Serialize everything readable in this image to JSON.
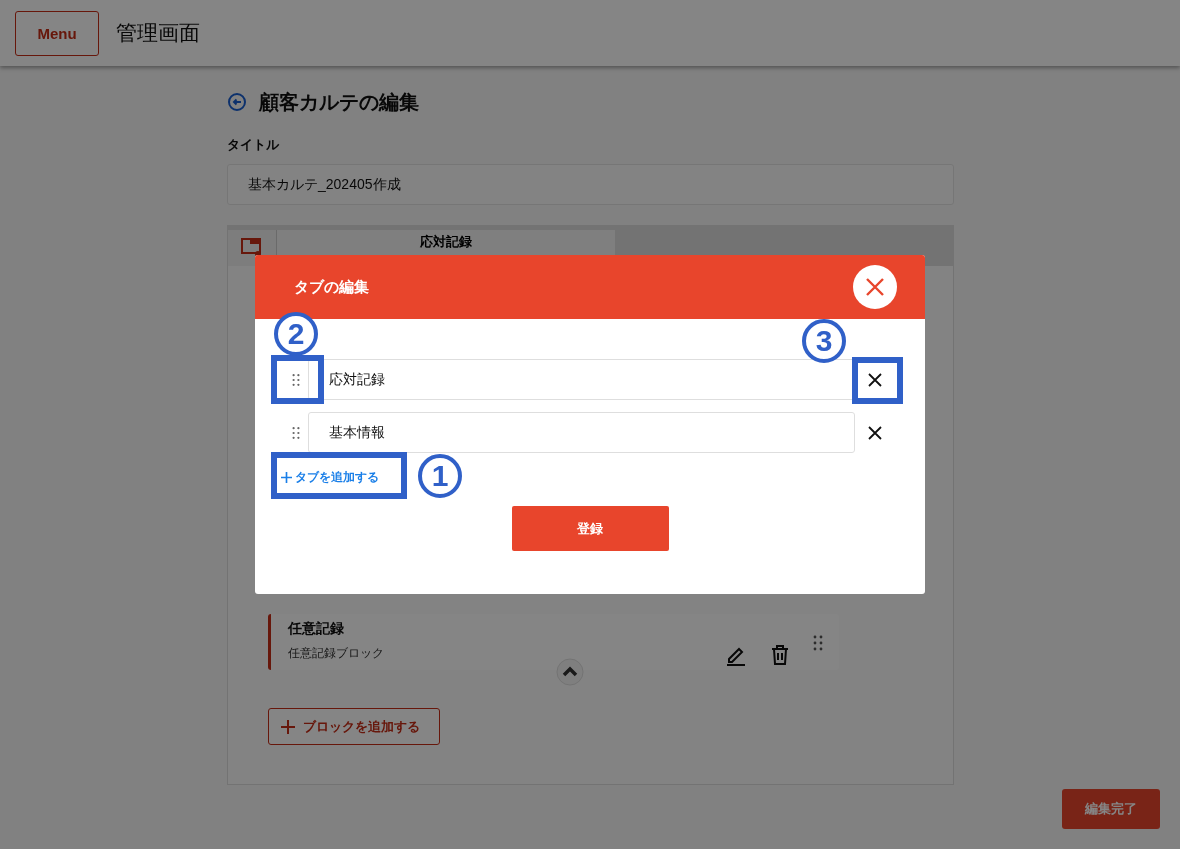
{
  "header": {
    "menu_button": "Menu",
    "title": "管理画面"
  },
  "page": {
    "heading": "顧客カルテの編集",
    "title_label": "タイトル",
    "title_value": "基本カルテ_202405作成"
  },
  "tabs": [
    {
      "label": "応対記録",
      "selected": true
    }
  ],
  "blocks": [
    {
      "title": "任意記録",
      "subtitle": "任意記録ブロック"
    }
  ],
  "add_block_button": "ブロックを追加する",
  "finish_button": "編集完了",
  "modal": {
    "title": "タブの編集",
    "rows": [
      {
        "value": "応対記録"
      },
      {
        "value": "基本情報"
      }
    ],
    "add_tab_link": "タブを追加する",
    "submit_button": "登録"
  },
  "annotations": [
    {
      "label": "2",
      "kind": "handle"
    },
    {
      "label": "3",
      "kind": "delete"
    },
    {
      "label": "1",
      "kind": "add"
    }
  ]
}
